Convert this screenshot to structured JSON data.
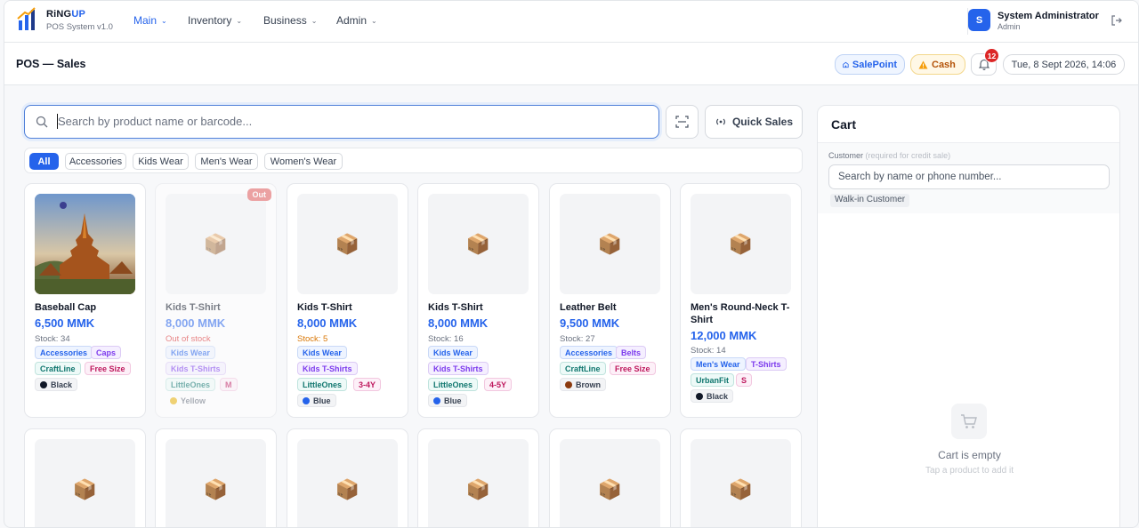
{
  "app": {
    "name_part1": "RiNG",
    "name_part2": "UP",
    "version": "POS System v1.0"
  },
  "nav": {
    "items": [
      {
        "label": "Main",
        "icon": "chevron-down-icon",
        "active": true
      },
      {
        "label": "Inventory",
        "icon": "chevron-down-icon"
      },
      {
        "label": "Business",
        "icon": "chevron-down-icon"
      },
      {
        "label": "Admin",
        "icon": "chevron-down-icon"
      }
    ]
  },
  "user": {
    "initial": "S",
    "name": "System Administrator",
    "role": "Admin",
    "logout_icon": "logout-icon"
  },
  "header": {
    "title": "POS — Sales",
    "salepoint": "SalePoint",
    "cash": "Cash",
    "notification_count": "12",
    "datetime": "Tue, 8 Sept 2026, 14:06"
  },
  "search": {
    "placeholder": "Search by product name or barcode...",
    "scan_icon": "barcode-scan-icon"
  },
  "quick_sales": {
    "label": "Quick Sales"
  },
  "categories": [
    "All",
    "Accessories",
    "Kids Wear",
    "Men's Wear",
    "Women's Wear"
  ],
  "products": [
    {
      "name": "Baseball Cap",
      "price": "6,500 MMK",
      "stock": "Stock: 34",
      "image": "pagoda-photo",
      "tags": [
        "Accessories",
        "Caps",
        "CraftLine",
        "Free Size"
      ],
      "color": "Black",
      "color_hex": "#111827"
    },
    {
      "name": "Kids T-Shirt",
      "price": "8,000 MMK",
      "stock": "Out of stock",
      "badge": "Out",
      "image": "box-icon",
      "tags": [
        "Kids Wear",
        "Kids T-Shirts",
        "LittleOnes",
        "M"
      ],
      "color": "Yellow",
      "color_hex": "#eab308"
    },
    {
      "name": "Kids T-Shirt",
      "price": "8,000 MMK",
      "stock": "Stock: 5",
      "image": "box-icon",
      "tags": [
        "Kids Wear",
        "Kids T-Shirts",
        "LittleOnes",
        "3-4Y"
      ],
      "color": "Blue",
      "color_hex": "#2563eb"
    },
    {
      "name": "Kids T-Shirt",
      "price": "8,000 MMK",
      "stock": "Stock: 16",
      "image": "box-icon",
      "tags": [
        "Kids Wear",
        "Kids T-Shirts",
        "LittleOnes",
        "4-5Y"
      ],
      "color": "Blue",
      "color_hex": "#2563eb"
    },
    {
      "name": "Leather Belt",
      "price": "9,500 MMK",
      "stock": "Stock: 27",
      "image": "box-icon",
      "tags": [
        "Accessories",
        "Belts",
        "CraftLine",
        "Free Size"
      ],
      "color": "Brown",
      "color_hex": "#8b3a0e"
    },
    {
      "name": "Men's Round-Neck T-Shirt",
      "price": "12,000 MMK",
      "stock": "Stock: 14",
      "image": "box-icon",
      "tags": [
        "Men's Wear",
        "T-Shirts",
        "UrbanFit",
        "S"
      ],
      "color": "Black",
      "color_hex": "#111827"
    }
  ],
  "cart": {
    "title": "Cart",
    "customer_label": "Customer",
    "customer_hint": "(required for credit sale)",
    "customer_placeholder": "Search by name or phone number...",
    "walkin": "Walk-in Customer",
    "empty_title": "Cart is empty",
    "empty_sub": "Tap a product to add it"
  }
}
